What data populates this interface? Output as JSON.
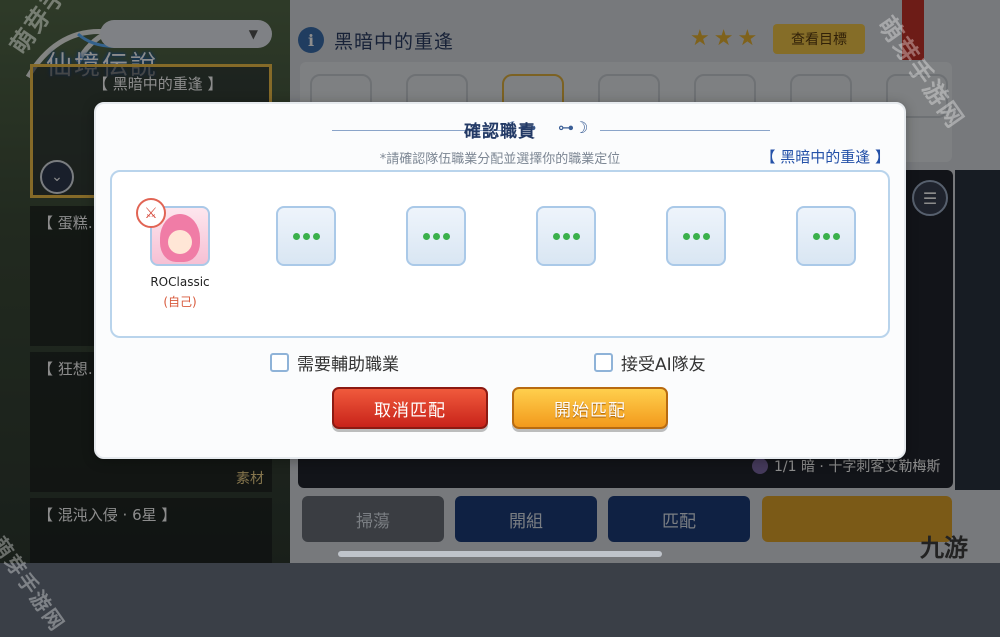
{
  "background": {
    "logo_text": "仙境伝說",
    "header_title": "黑暗中的重逢",
    "info_icon": "i",
    "stars": [
      "★",
      "★",
      "★"
    ],
    "goal_button": "查看目標",
    "selected_card_title": "【 黑暗中的重逢 】",
    "cards": [
      {
        "title": "【 蛋糕…",
        "tag": ""
      },
      {
        "title": "【 狂想…",
        "tag": "素材"
      },
      {
        "title": "【 混沌入侵 · 6星 】",
        "tag": ""
      }
    ],
    "monster_text": "1/1 暗 · 十字刺客艾勒梅斯",
    "bottom_buttons": [
      "掃蕩",
      "開組",
      "匹配",
      ""
    ],
    "watermark": "萌芽手游网",
    "corner_logo": "九游"
  },
  "modal": {
    "title": "確認職責",
    "subtitle": "*請確認隊伍職業分配並選擇你的職業定位",
    "dungeon_tag": "【 黑暗中的重逢 】",
    "self": {
      "name": "ROClassic",
      "tag": "(自己)",
      "job_icon": "sword-icon"
    },
    "empty_slots": 5,
    "options": [
      {
        "label": "需要輔助職業",
        "checked": false
      },
      {
        "label": "接受AI隊友",
        "checked": false
      }
    ],
    "cancel_button": "取消匹配",
    "start_button": "開始匹配"
  },
  "colors": {
    "cancel": "#d8331f",
    "start": "#f6ae2a",
    "title": "#233a66",
    "accent_blue": "#2451a8"
  }
}
